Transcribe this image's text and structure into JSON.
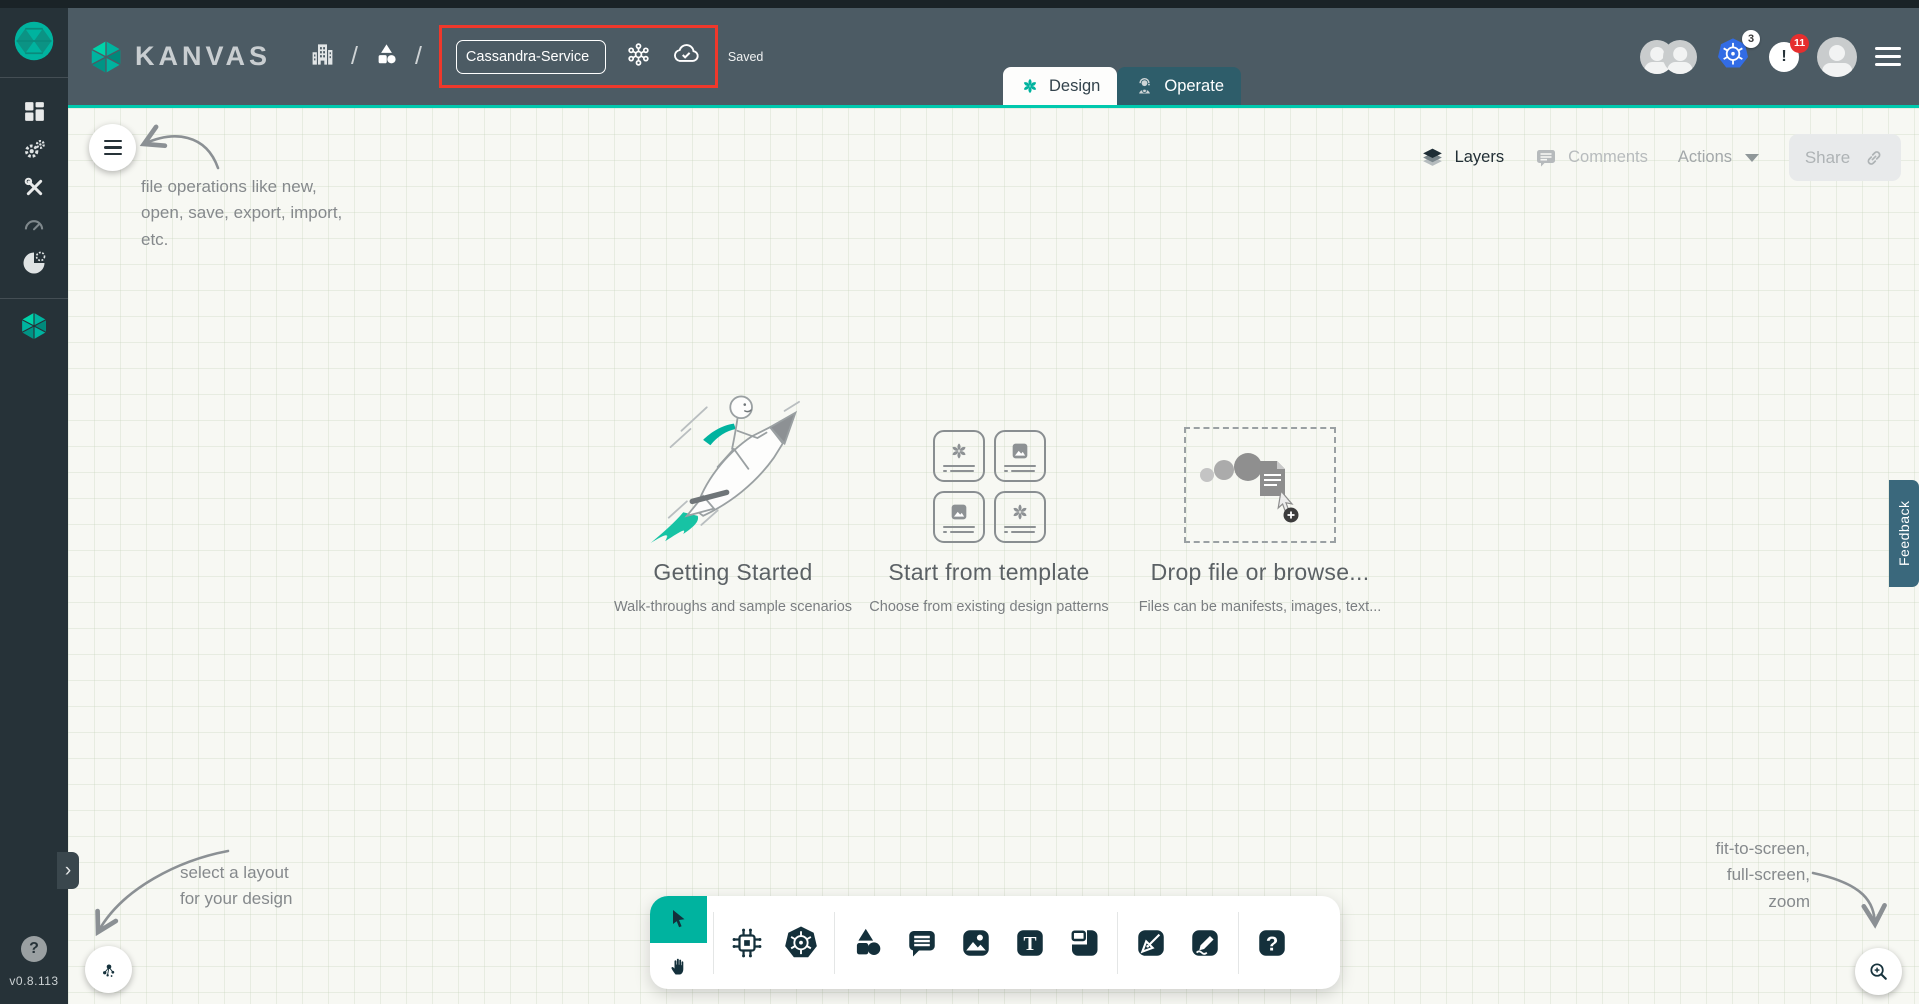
{
  "header": {
    "brand": "KANVAS",
    "separator": "/",
    "design_name": "Cassandra-Service",
    "saved_label": "Saved",
    "k8s_context_badge": "3",
    "notification_glyph": "!",
    "notification_badge": "11",
    "tabs": [
      {
        "label": "Design"
      },
      {
        "label": "Operate"
      }
    ]
  },
  "sidebar": {
    "version": "v0.8.113",
    "help_glyph": "?",
    "expand_glyph": "›"
  },
  "panel": {
    "layers_label": "Layers",
    "comments_label": "Comments",
    "actions_label": "Actions",
    "share_label": "Share"
  },
  "cards": [
    {
      "title": "Getting Started",
      "subtitle": "Walk-throughs and sample scenarios"
    },
    {
      "title": "Start from template",
      "subtitle": "Choose from existing design patterns"
    },
    {
      "title": "Drop file or browse...",
      "subtitle": "Files can be manifests, images, text..."
    }
  ],
  "annotations": {
    "file_ops": [
      "file operations like new,",
      "open, save, export, import,",
      "etc."
    ],
    "layout": [
      "select a layout",
      "for your design"
    ],
    "zoom": [
      "fit-to-screen,",
      "full-screen,",
      "zoom"
    ]
  },
  "toolbar": {
    "text_tool_glyph": "T",
    "help_glyph": "?"
  },
  "feedback_label": "Feedback",
  "colors": {
    "accent": "#00b39f",
    "accent_bright": "#00d3a9",
    "highlight_red": "#f0382b",
    "k8s_blue": "#326ce5",
    "badge_red": "#e62e2e",
    "header_bg": "#4c5b64",
    "sidebar_bg": "#263238",
    "canvas_bg": "#f7f8f3",
    "feedback_bg": "#3a687c"
  }
}
